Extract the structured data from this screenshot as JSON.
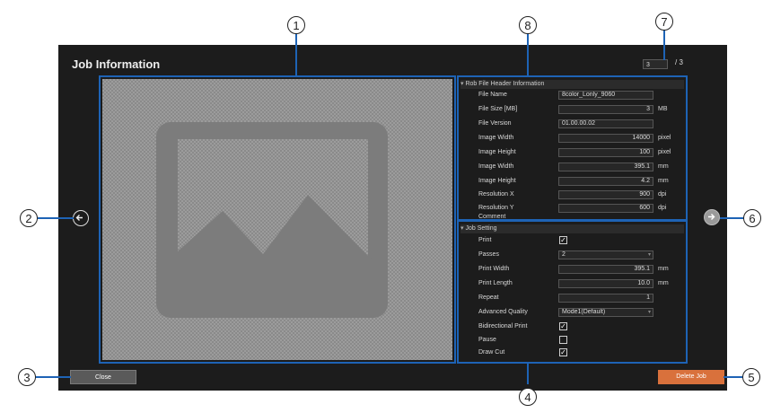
{
  "dialog": {
    "title": "Job Information"
  },
  "pager": {
    "current": "3",
    "total": "/ 3"
  },
  "header_section": {
    "title": "Rob File Header Information",
    "rows": [
      {
        "label": "File Name",
        "value": "8color_Lonly_9060",
        "unit": ""
      },
      {
        "label": "File Size [MB]",
        "value": "3",
        "unit": "MB"
      },
      {
        "label": "File Version",
        "value": "01.00.00.02",
        "unit": ""
      },
      {
        "label": "Image Width",
        "value": "14000",
        "unit": "pixel"
      },
      {
        "label": "Image Height",
        "value": "100",
        "unit": "pixel"
      },
      {
        "label": "Image Width",
        "value": "395.1",
        "unit": "mm"
      },
      {
        "label": "Image Height",
        "value": "4.2",
        "unit": "mm"
      },
      {
        "label": "Resolution X",
        "value": "900",
        "unit": "dpi"
      },
      {
        "label": "Resolution Y",
        "value": "600",
        "unit": "dpi"
      },
      {
        "label": "Comment",
        "value": "",
        "unit": ""
      }
    ]
  },
  "job_section": {
    "title": "Job Setting",
    "print": {
      "label": "Print",
      "checked": true
    },
    "passes": {
      "label": "Passes",
      "value": "2"
    },
    "print_width": {
      "label": "Print Width",
      "value": "395.1",
      "unit": "mm"
    },
    "print_length": {
      "label": "Print Length",
      "value": "10.0",
      "unit": "mm"
    },
    "repeat": {
      "label": "Repeat",
      "value": "1"
    },
    "advanced_quality": {
      "label": "Advanced Quality",
      "value": "Mode1(Default)"
    },
    "bidirectional": {
      "label": "Bidirectional Print",
      "checked": true
    },
    "pause": {
      "label": "Pause",
      "checked": false
    },
    "draw_cut": {
      "label": "Draw Cut",
      "checked": true
    }
  },
  "buttons": {
    "close": "Close",
    "delete": "Delete Job"
  },
  "callouts": [
    "1",
    "2",
    "3",
    "4",
    "5",
    "6",
    "7",
    "8"
  ],
  "colors": {
    "accent": "#1e63b5",
    "delete_button": "#d9713c",
    "panel": "#1c1c1c"
  },
  "icons": {
    "prev": "arrow-left-circle-icon",
    "next": "arrow-right-circle-icon",
    "preview": "image-placeholder-icon"
  }
}
